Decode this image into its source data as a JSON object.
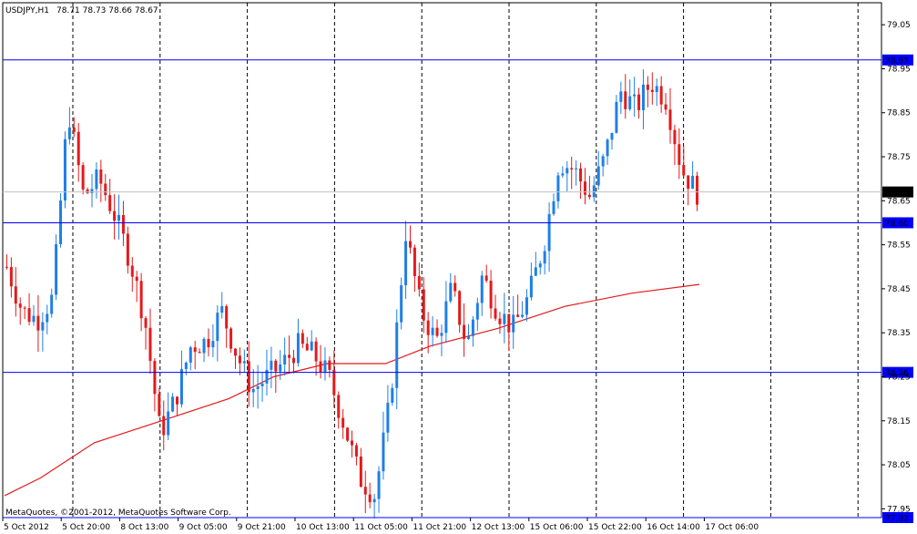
{
  "header": {
    "symbol": "USDJPY,H1",
    "ohlc": "78.71 78.73 78.66 78.67"
  },
  "footer": {
    "copyright": "MetaQuotes, ©2001-2012, MetaQuotes Software Corp."
  },
  "colors": {
    "bull": "#1f7fe6",
    "bear": "#e31a1c",
    "level_line": "#0000ff",
    "moving_average": "#e31a1c",
    "current_price_line": "#c0c0c0",
    "grid": "#000000"
  },
  "chart_data": {
    "type": "candlestick",
    "title": "USDJPY,H1",
    "ylim": [
      77.93,
      79.1
    ],
    "y_ticks": [
      "79.05",
      "78.95",
      "78.85",
      "78.75",
      "78.65",
      "78.55",
      "78.45",
      "78.35",
      "78.25",
      "78.15",
      "78.05",
      "77.95"
    ],
    "x_ticks": [
      "5 Oct 2012",
      "5 Oct 20:00",
      "8 Oct 13:00",
      "9 Oct 05:00",
      "9 Oct 21:00",
      "10 Oct 13:00",
      "11 Oct 05:00",
      "11 Oct 21:00",
      "12 Oct 13:00",
      "15 Oct 06:00",
      "15 Oct 22:00",
      "16 Oct 14:00",
      "17 Oct 06:00"
    ],
    "price_labels": [
      {
        "label": "78.97",
        "value": 78.97,
        "kind": "level"
      },
      {
        "label": "78.67",
        "value": 78.67,
        "kind": "current"
      },
      {
        "label": "78.60",
        "value": 78.6,
        "kind": "level"
      },
      {
        "label": "78.26",
        "value": 78.26,
        "kind": "level"
      },
      {
        "label": "77.93",
        "value": 77.93,
        "kind": "level"
      }
    ],
    "grid": true,
    "ohlc_close_anchors": [
      78.5,
      78.4,
      78.38,
      78.43,
      78.86,
      78.66,
      78.7,
      78.62,
      78.52,
      78.38,
      78.12,
      78.2,
      78.32,
      78.33,
      78.4,
      78.3,
      78.22,
      78.25,
      78.28,
      78.32,
      78.3,
      78.25,
      78.14,
      78.02,
      77.98,
      78.2,
      78.58,
      78.4,
      78.33,
      78.45,
      78.32,
      78.48,
      78.4,
      78.36,
      78.43,
      78.55,
      78.74,
      78.72,
      78.66,
      78.75,
      78.9,
      78.86,
      78.92,
      78.88,
      78.72,
      78.67
    ],
    "moving_average": [
      {
        "x": 0,
        "y": 77.98
      },
      {
        "x": 8,
        "y": 78.02
      },
      {
        "x": 20,
        "y": 78.1
      },
      {
        "x": 35,
        "y": 78.15
      },
      {
        "x": 50,
        "y": 78.2
      },
      {
        "x": 60,
        "y": 78.25
      },
      {
        "x": 72,
        "y": 78.28
      },
      {
        "x": 85,
        "y": 78.28
      },
      {
        "x": 95,
        "y": 78.32
      },
      {
        "x": 110,
        "y": 78.36
      },
      {
        "x": 125,
        "y": 78.41
      },
      {
        "x": 140,
        "y": 78.44
      },
      {
        "x": 155,
        "y": 78.46
      }
    ]
  }
}
